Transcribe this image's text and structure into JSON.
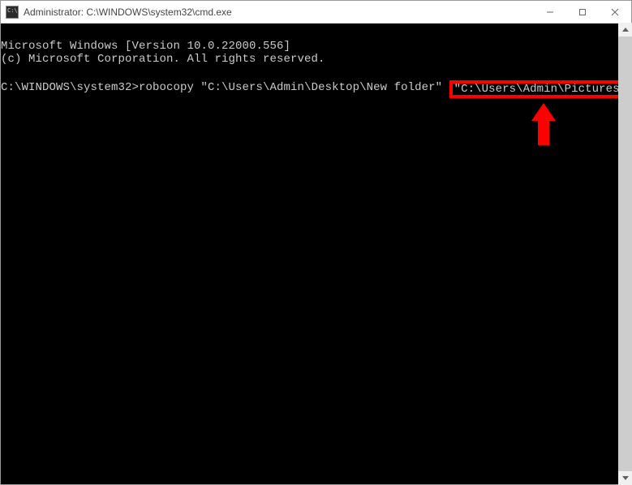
{
  "window": {
    "title": "Administrator: C:\\WINDOWS\\system32\\cmd.exe"
  },
  "terminal": {
    "line1": "Microsoft Windows [Version 10.0.22000.556]",
    "line2": "(c) Microsoft Corporation. All rights reserved.",
    "prompt_prefix": "C:\\WINDOWS\\system32>",
    "command_part1": "robocopy \"C:\\Users\\Admin\\Desktop\\New folder\" ",
    "command_highlighted": "\"C:\\Users\\Admin\\Pictures\\Copy\""
  },
  "colors": {
    "highlight": "#ff0000",
    "terminal_bg": "#000000",
    "terminal_fg": "#cccccc"
  }
}
